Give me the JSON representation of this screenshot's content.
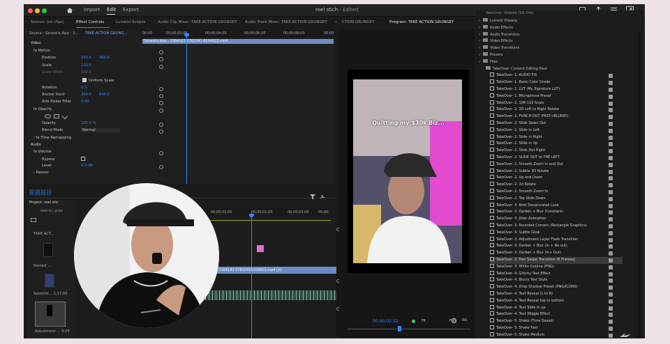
{
  "window": {
    "title": "reel stich",
    "title_state": "Edited",
    "menu": [
      "Import",
      "Edit",
      "Export"
    ],
    "active_menu": "Edit"
  },
  "source_tabs": {
    "source": "Source: (no clips)",
    "effect_controls": "Effect Controls",
    "lumetri": "Lumetri Scopes",
    "audio_clip_mixer": "Audio Clip Mixer: TAKE ACTION GRUNGEY",
    "audio_track_mixer": "Audio Track Mixer: TAKE ACTION GRUNGEY",
    "take_action_cut": "CTION GRUNGEY",
    "program": "Program: TAKE ACTION GRUNGEY"
  },
  "effect_controls": {
    "source_label": "Source - Savestix.App - 3...",
    "sequence_label": "TAKE ACTION GRUNG...",
    "ruler": [
      "00:00",
      "00;00;02;00",
      "00;00;04;00",
      "00;00;06;00",
      "00;00;08;00",
      "00;00"
    ],
    "clip_name": "Savestix.App - 3384183 0781041 6104922.mp4",
    "video_header": "Video",
    "motion": "Motion",
    "position_label": "Position",
    "position_x": "540.0",
    "position_y": "960.0",
    "scale_label": "Scale",
    "scale_value": "135.0",
    "scale_width_label": "Scale Width",
    "scale_width_value": "100.0",
    "uniform_scale": "Uniform Scale",
    "rotation_label": "Rotation",
    "rotation_value": "0.0",
    "anchor_label": "Anchor Point",
    "anchor_x": "360.0",
    "anchor_y": "640.0",
    "flicker_label": "Anti-flicker Filter",
    "flicker_value": "0.00",
    "opacity_header": "Opacity",
    "opacity_label": "Opacity",
    "opacity_value": "100.0 %",
    "blend_label": "Blend Mode",
    "blend_value": "Normal",
    "time_remap": "Time Remapping",
    "audio_header": "Audio",
    "volume": "Volume",
    "bypass": "Bypass",
    "level_label": "Level",
    "level_value": "0.0 dB",
    "panner": "Panner",
    "timecode": "00;00;02;12"
  },
  "project": {
    "tab": "Project: reel stic",
    "file": "reel st...prpr",
    "items": [
      "TAKE ACT...",
      "Nested ...",
      "Savestix...  1;17;00",
      "Adjustment ...  4;29"
    ]
  },
  "timeline": {
    "ruler": [
      "00;00;01;00",
      "00;00;02;00",
      "00;00;03;00",
      "00;00;"
    ],
    "clip_label": "x.App - 3384183 07810416104922.mp4 [V]"
  },
  "program": {
    "caption": "Quitting my $30k Biz...",
    "timecode": "00;00;02;12",
    "zoom": "Fit",
    "quality": "Full",
    "end_time": "00;"
  },
  "effects_panel": {
    "top_truncated": "TakeOver- Wobble (Stk Dtk)",
    "folders": [
      "Lumetri Presets",
      "Audio Effects",
      "Audio Transitions",
      "Video Effects",
      "Video Transitions",
      "Presets",
      "Files"
    ],
    "pack": "TakeOver- Content Editing Pack",
    "effects": [
      "TakeOver- 1. AUDIO FIX",
      "TakeOver- 1. Basic Color Grade",
      "TakeOver- 1. LUT (My Signature LUT)",
      "TakeOver- 1. Microphone Preset",
      "TakeOver- 2. 106-110 Scale",
      "TakeOver- 2. 3D Left to Right Rotate",
      "TakeOver- 2. PUNCH OUT (FAST+BLURRY)",
      "TakeOver- 2. Slide Down Out",
      "TakeOver- 2. Slide in Left",
      "TakeOver- 2. Slide in Right",
      "TakeOver- 2. Slide in Up",
      "TakeOver- 2. Slide Out Right",
      "TakeOver- 2. SLIDE OUT to THE LEFT",
      "TakeOver- 2. Smooth Zoom in and Out",
      "TakeOver- 2. Subtle 3D Rotate",
      "TakeOver- 2. Up and Down",
      "TakeOver- 2. 3d Rotate",
      "TakeOver- 2. Smooth Zoom In",
      "TakeOver- 2. Top Slide Down",
      "TakeOver- 3. Broll Desaturated Look",
      "TakeOver- 3. Darken + Blur (Constant)",
      "TakeOver- 3. Jitter Animation",
      "TakeOver- 3. Rounded Corners (Rectangle Graphics)",
      "TakeOver- 3. Subtle Glow",
      "TakeOver- 3. Adjustment Layer Flash Transition",
      "TakeOver- 3. Darken + Blur (In + No out)",
      "TakeOver- 3. Darken + Blur (In+ Out)",
      "TakeOver- 3. Fast Swipe Transition (6 Frames)",
      "TakeOver- 3. White Outline (PNG)",
      "TakeOver- 4. Glitchy Text Effect",
      "TakeOver- 4. Blurry Text Style",
      "TakeOver- 4. Drop Shadow Preset (PNG/ICONS)",
      "TakeOver- 4. Text Reveal (L to R)",
      "TakeOver- 4. Text Reveal top to bottom",
      "TakeOver- 4. Text Slide in up",
      "TakeOver- 4. Text Wiggle Effect",
      "TakeOver- 5. Shake (Time Based)",
      "TakeOver- 5. Shake Fast",
      "TakeOver- 5. Shake Medium"
    ],
    "selected_index": 27
  },
  "colors": {
    "accent": "#2f86ff",
    "clip_blue": "#5a80b8",
    "pink_clip": "#d96fd0",
    "window_dot_red": "#fe5f57",
    "window_dot_yellow": "#febc2e",
    "window_dot_green": "#28c840"
  }
}
